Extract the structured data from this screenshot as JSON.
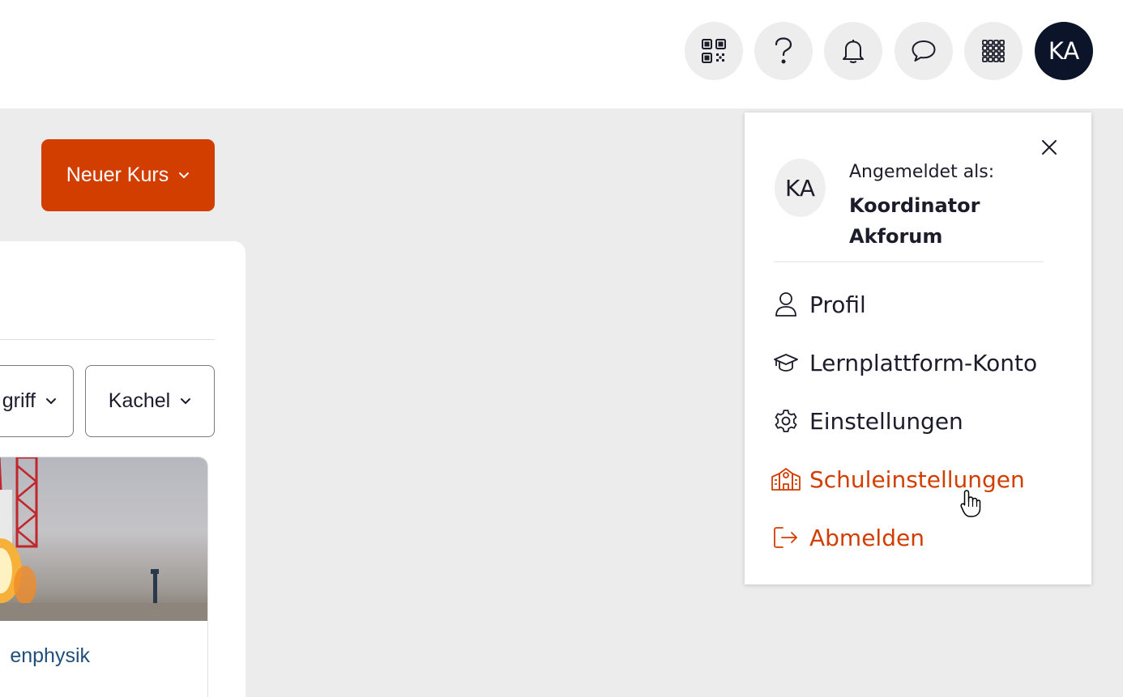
{
  "header": {
    "avatar_initials": "KA",
    "icons": [
      "qr-code-icon",
      "help-icon",
      "bell-icon",
      "chat-icon",
      "apps-grid-icon"
    ]
  },
  "toolbar": {
    "new_course_label": "Neuer Kurs"
  },
  "filters": {
    "access_select_label": "Zugriff",
    "access_select_visible": "griff",
    "view_select_label": "Kachel"
  },
  "course_card": {
    "title_visible": "enphysik"
  },
  "user_menu": {
    "avatar_initials": "KA",
    "signed_in_label": "Angemeldet als:",
    "user_name": "Koordinator Akforum",
    "items": [
      {
        "label": "Profil",
        "icon": "user-icon"
      },
      {
        "label": "Lernplattform-Konto",
        "icon": "graduation-cap-icon"
      },
      {
        "label": "Einstellungen",
        "icon": "gear-icon"
      },
      {
        "label": "Schuleinstellungen",
        "icon": "school-building-icon"
      },
      {
        "label": "Abmelden",
        "icon": "logout-icon"
      }
    ]
  },
  "colors": {
    "accent": "#d13e00",
    "avatar_bg": "#0b1428",
    "link": "#1f4f7a",
    "background": "#ececec"
  }
}
